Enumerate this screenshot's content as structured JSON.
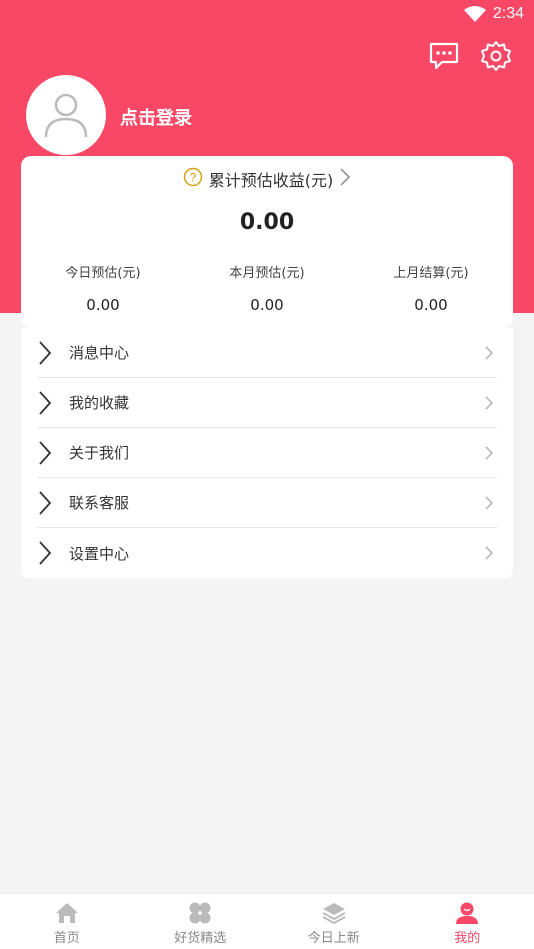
{
  "status_bar": {
    "time": "2:34"
  },
  "header": {
    "login_text": "点击登录"
  },
  "earnings": {
    "title": "累计预估收益(元)",
    "total": "0.00",
    "stats": [
      {
        "label": "今日预估(元)",
        "value": "0.00"
      },
      {
        "label": "本月预估(元)",
        "value": "0.00"
      },
      {
        "label": "上月结算(元)",
        "value": "0.00"
      }
    ]
  },
  "menu": {
    "items": [
      {
        "label": "消息中心"
      },
      {
        "label": "我的收藏"
      },
      {
        "label": "关于我们"
      },
      {
        "label": "联系客服"
      },
      {
        "label": "设置中心"
      }
    ]
  },
  "tabbar": {
    "items": [
      {
        "label": "首页",
        "icon": "home-icon"
      },
      {
        "label": "好货精选",
        "icon": "clover-icon"
      },
      {
        "label": "今日上新",
        "icon": "layers-icon"
      },
      {
        "label": "我的",
        "icon": "profile-icon"
      }
    ],
    "active_index": 3
  },
  "colors": {
    "accent": "#f94766",
    "background": "#f4f4f4",
    "question_icon": "#d4a017"
  }
}
